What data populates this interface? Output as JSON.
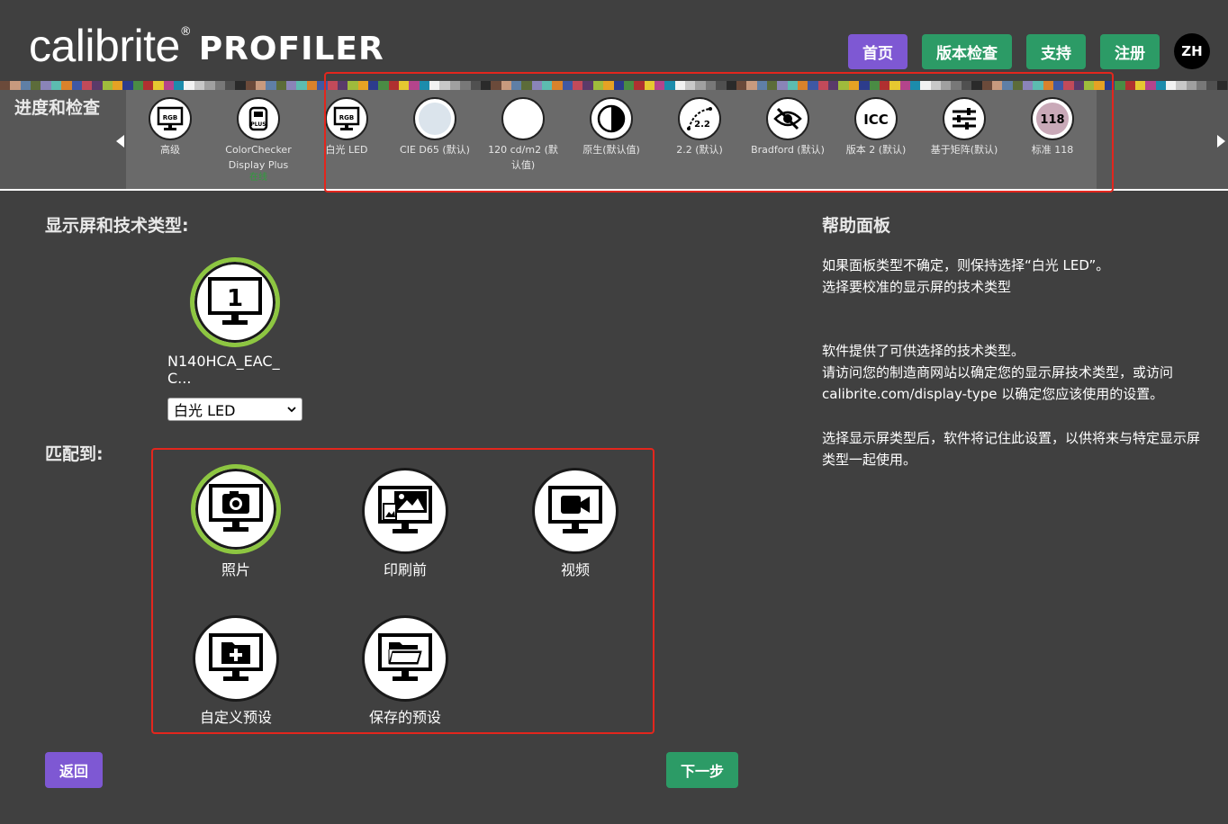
{
  "header": {
    "logo_text": "calibrite",
    "logo_reg": "®",
    "logo_product": "PROFILER",
    "nav": {
      "home": "首页",
      "version_check": "版本检查",
      "support": "支持",
      "register": "注册",
      "language": "ZH"
    }
  },
  "progress": {
    "title": "进度和检查",
    "steps": [
      {
        "label": "高级",
        "icon": "rgb-monitor-icon"
      },
      {
        "label": "ColorChecker Display Plus",
        "sub": "在线",
        "icon": "plus-device-icon"
      },
      {
        "label": "白光 LED",
        "icon": "rgb-monitor-icon"
      },
      {
        "label": "CIE D65 (默认)",
        "icon": "white-point-icon"
      },
      {
        "label": "120 cd/m2 (默认值)",
        "icon": "luminance-icon"
      },
      {
        "label": "原生(默认值)",
        "icon": "contrast-icon"
      },
      {
        "label": "2.2 (默认)",
        "icon": "gamma-curve-icon"
      },
      {
        "label": "Bradford (默认)",
        "icon": "eye-slash-icon"
      },
      {
        "label": "版本 2 (默认)",
        "icon": "icc-icon"
      },
      {
        "label": "基于矩阵(默认)",
        "icon": "sliders-icon"
      },
      {
        "label": "标准 118",
        "icon": "patch-118-icon"
      }
    ]
  },
  "main": {
    "display_section_title": "显示屏和技术类型:",
    "display_number": "1",
    "display_name": "N140HCA_EAC_ C...",
    "display_type_selected": "白光 LED",
    "match_title": "匹配到:",
    "options": [
      {
        "label": "照片",
        "icon": "camera-monitor-icon",
        "selected": true
      },
      {
        "label": "印刷前",
        "icon": "image-monitor-icon",
        "selected": false
      },
      {
        "label": "视频",
        "icon": "video-monitor-icon",
        "selected": false
      },
      {
        "label": "自定义预设",
        "icon": "folder-plus-monitor-icon",
        "selected": false
      },
      {
        "label": "保存的预设",
        "icon": "folder-open-monitor-icon",
        "selected": false
      }
    ]
  },
  "help": {
    "title": "帮助面板",
    "p1_line1": "如果面板类型不确定，则保持选择“白光 LED”。",
    "p1_line2": "选择要校准的显示屏的技术类型",
    "p2_line1": "软件提供了可供选择的技术类型。",
    "p2_line2": "请访问您的制造商网站以确定您的显示屏技术类型，或访问",
    "p2_line3": "calibrite.com/display-type 以确定您应该使用的设置。",
    "p3": "选择显示屏类型后，软件将记住此设置，以供将来与特定显示屏类型一起使用。"
  },
  "footer": {
    "back": "返回",
    "next": "下一步"
  },
  "colors": {
    "background": "#404040",
    "purple": "#7e58d3",
    "green": "#2c9b66",
    "selected_ring": "#8dc641",
    "highlight": "#e3261d"
  }
}
